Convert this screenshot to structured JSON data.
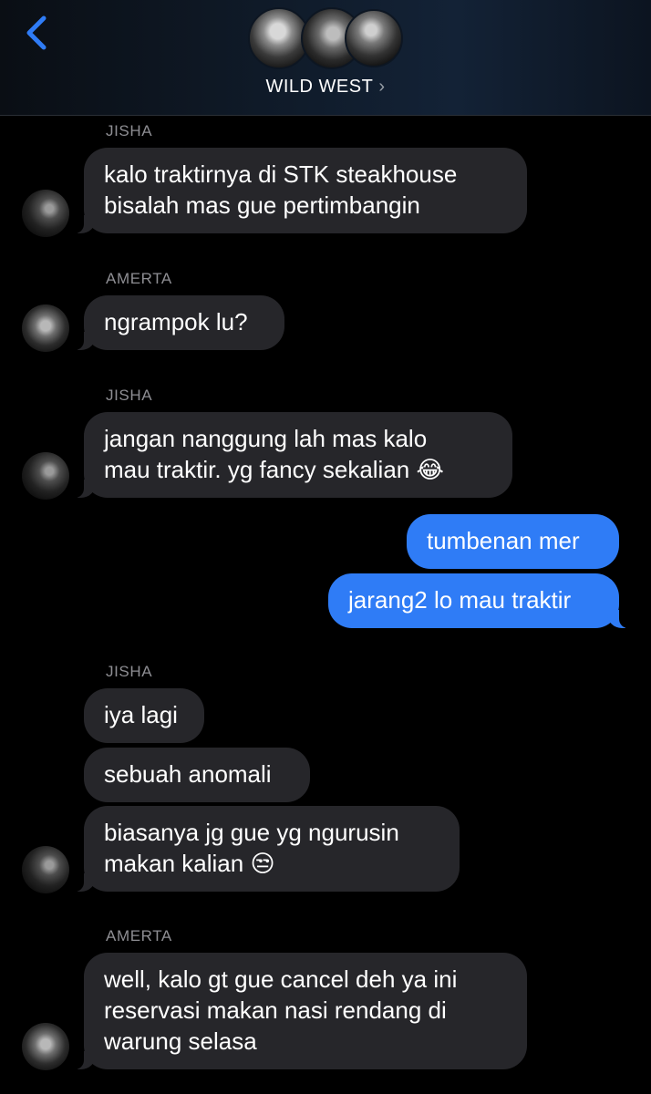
{
  "header": {
    "group_name": "WILD WEST",
    "chevron": "›",
    "back_icon": "chevron-left-icon",
    "accent_color": "#2f7cf6"
  },
  "messages": [
    {
      "sender": "JISHA"
    },
    {
      "text_1": "kalo traktirnya di STK steakhouse",
      "text_2": "bisalah mas gue pertimbangin"
    },
    {
      "sender": "AMERTA"
    },
    {
      "text": "ngrampok lu?"
    },
    {
      "sender": "JISHA"
    },
    {
      "text_1": "jangan nanggung lah mas kalo",
      "text_2": "mau traktir. yg fancy sekalian",
      "emoji": "😂"
    },
    {
      "text": "tumbenan mer"
    },
    {
      "text": "jarang2 lo mau traktir"
    },
    {
      "sender": "JISHA"
    },
    {
      "text": "iya lagi"
    },
    {
      "text": "sebuah anomali"
    },
    {
      "text_1": "biasanya jg gue yg ngurusin",
      "text_2": "makan kalian",
      "emoji": "😒"
    },
    {
      "sender": "AMERTA"
    },
    {
      "text_1": "well, kalo gt gue cancel deh ya ini",
      "text_2": "reservasi makan nasi rendang di",
      "text_3": "warung selasa"
    }
  ],
  "colors": {
    "incoming_bubble": "#26262a",
    "outgoing_bubble": "#2f7cf6",
    "sender_label": "#8e8e93",
    "background": "#000000"
  }
}
